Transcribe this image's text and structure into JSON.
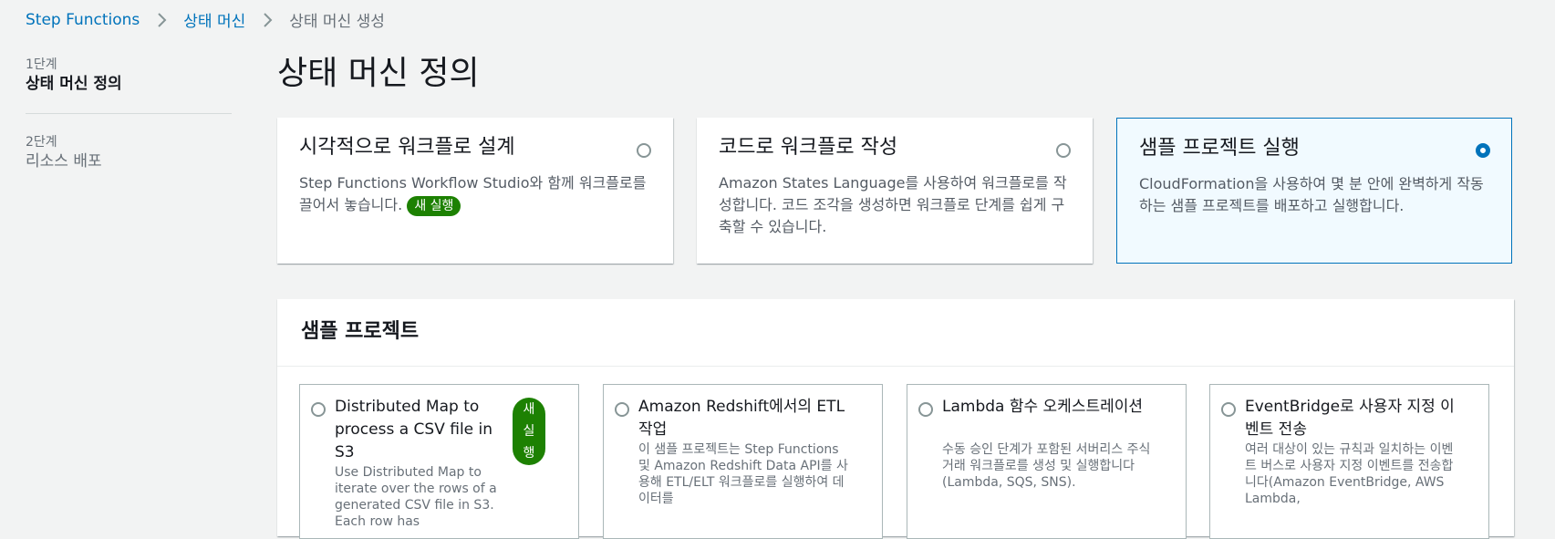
{
  "breadcrumb": {
    "items": [
      "Step Functions",
      "상태 머신",
      "상태 머신 생성"
    ]
  },
  "steps": [
    {
      "number": "1단계",
      "title": "상태 머신 정의"
    },
    {
      "number": "2단계",
      "title": "리소스 배포"
    }
  ],
  "page_title": "상태 머신 정의",
  "tiles": [
    {
      "title": "시각적으로 워크플로 설계",
      "description": "Step Functions Workflow Studio와 함께 워크플로를 끌어서 놓습니다.",
      "badge": "새 실행"
    },
    {
      "title": "코드로 워크플로 작성",
      "description": "Amazon States Language를 사용하여 워크플로를 작성합니다. 코드 조각을 생성하면 워크플로 단계를 쉽게 구축할 수 있습니다."
    },
    {
      "title": "샘플 프로젝트 실행",
      "description": "CloudFormation을 사용하여 몇 분 안에 완벽하게 작동하는 샘플 프로젝트를 배포하고 실행합니다."
    }
  ],
  "sample_projects": {
    "title": "샘플 프로젝트",
    "items": [
      {
        "title": "Distributed Map to process a CSV file in S3",
        "badge": "새 실행",
        "description": "Use Distributed Map to iterate over the rows of a generated CSV file in S3. Each row has"
      },
      {
        "title": "Amazon Redshift에서의 ETL 작업",
        "description": "이 샘플 프로젝트는 Step Functions 및 Amazon Redshift Data API를 사용해 ETL/ELT 워크플로를 실행하여 데이터를"
      },
      {
        "title": "Lambda 함수 오케스트레이션",
        "description": "수동 승인 단계가 포함된 서버리스 주식 거래 워크플로를 생성 및 실행합니다(Lambda, SQS, SNS)."
      },
      {
        "title": "EventBridge로 사용자 지정 이벤트 전송",
        "description": "여러 대상이 있는 규칙과 일치하는 이벤트 버스로 사용자 지정 이벤트를 전송합니다(Amazon EventBridge, AWS Lambda,"
      }
    ]
  },
  "colors": {
    "link": "#0073bb",
    "selected": "#0073bb",
    "badge": "#1d8102",
    "muted": "#687078"
  },
  "icons": {
    "breadcrumb_separator": "chevron-right-icon"
  }
}
